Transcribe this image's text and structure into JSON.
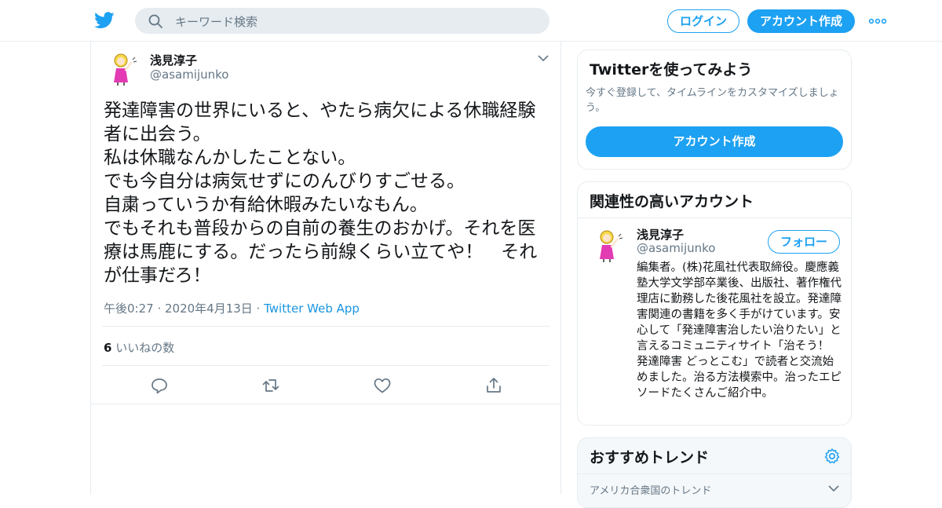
{
  "header": {
    "logo_icon": "twitter-bird-icon",
    "search": {
      "placeholder": "キーワード検索",
      "icon": "search-icon"
    },
    "login_label": "ログイン",
    "signup_label": "アカウント作成",
    "more_icon": "more-dots-icon"
  },
  "tweet": {
    "author_name": "浅見淳子",
    "author_handle": "@asamijunko",
    "text": "発達障害の世界にいると、やたら病欠による休職経験者に出会う。\n私は休職なんかしたことない。\nでも今自分は病気せずにのんびりすごせる。\n自粛っていうか有給休暇みたいなもん。\nでもそれも普段からの自前の養生のおかげ。それを医療は馬鹿にする。だったら前線くらい立てや！　それが仕事だろ！",
    "timestamp": "午後0:27 · 2020年4月13日 · ",
    "via": "Twitter Web App",
    "like_count": "6",
    "like_label": " いいねの数",
    "actions": [
      "reply-icon",
      "retweet-icon",
      "like-icon",
      "share-icon"
    ]
  },
  "sidebar": {
    "try_card": {
      "title": "Twitterを使ってみよう",
      "subtitle": "今すぐ登録して、タイムラインをカスタマイズしましょう。",
      "cta": "アカウント作成"
    },
    "related": {
      "title": "関連性の高いアカウント",
      "name": "浅見淳子",
      "handle": "@asamijunko",
      "follow_label": "フォロー",
      "bio": "編集者。(株)花風社代表取締役。慶應義塾大学文学部卒業後、出版社、著作権代理店に勤務した後花風社を設立。発達障害関連の書籍を多く手がけています。安心して「発達障害治したい治りたい」と言えるコミュニティサイト「治そう！ 発達障害 どっとこむ」で読者と交流始めました。治る方法模索中。治ったエピソードたくさんご紹介中。"
    },
    "trends": {
      "title": "おすすめトレンド",
      "location": "アメリカ合衆国のトレンド"
    }
  },
  "colors": {
    "brand": "#1da1f2",
    "muted": "#657786",
    "border": "#e6ecf0"
  }
}
